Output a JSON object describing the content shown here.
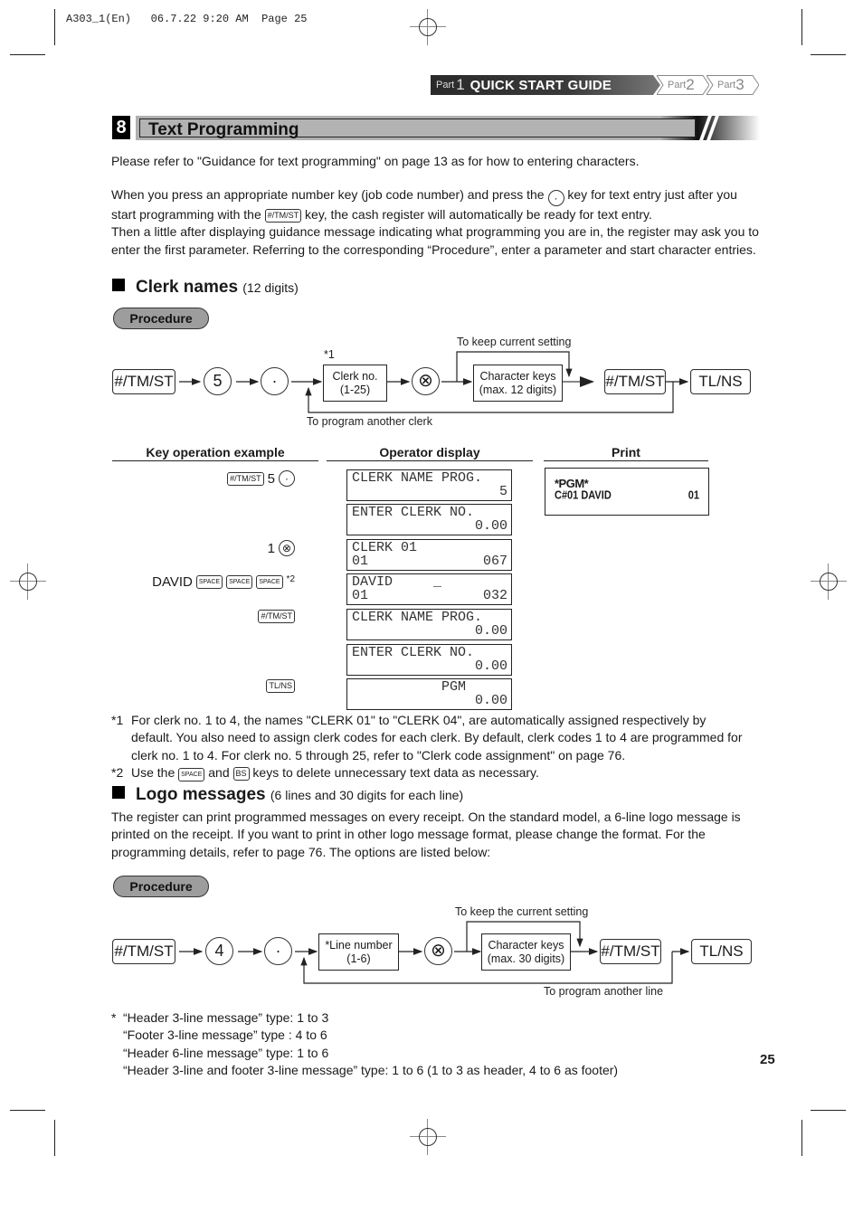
{
  "slug": {
    "file": "A303_1(En)",
    "date": "06.7.22",
    "time": "9:20 AM",
    "page_label": "Page 25"
  },
  "nav": {
    "parts": [
      {
        "prefix": "Part",
        "num": "1",
        "title": "QUICK START GUIDE",
        "active": true
      },
      {
        "prefix": "Part",
        "num": "2",
        "active": false
      },
      {
        "prefix": "Part",
        "num": "3",
        "active": false
      }
    ]
  },
  "section": {
    "number": "8",
    "title": "Text Programming"
  },
  "intro": {
    "p1": "Please refer to \"Guidance for text programming\" on page 13 as for how to entering characters.",
    "p2_a": "When you press an appropriate number key (job code number) and press the",
    "p2_key1": "·",
    "p2_b": "key for text entry just after you",
    "p2_c": "start programming with the",
    "p2_key2": "#/TM/ST",
    "p2_d": "key, the cash register will automatically be ready for text entry.",
    "p3": "Then a little after displaying guidance message indicating what programming you are in, the register may ask you to",
    "p4": "enter the first parameter.  Referring to the corresponding “Procedure”, enter a parameter and start character entries."
  },
  "clerk": {
    "heading": "Clerk names",
    "heading_sub": "(12 digits)",
    "procedure_label": "Procedure",
    "flow": {
      "key_start": "#/TM/ST",
      "key_num": "5",
      "key_dot": "·",
      "note1": "*1",
      "box1": [
        "Clerk no.",
        "(1-25)"
      ],
      "key_x": "⊗",
      "box2": [
        "Character keys",
        "(max. 12 digits)"
      ],
      "keep_note": "To keep current setting",
      "key_end1": "#/TM/ST",
      "key_end2": "TL/NS",
      "loop_note": "To program another clerk"
    },
    "columns": {
      "keyop": "Key operation example",
      "display": "Operator display",
      "print": "Print"
    },
    "rows": [
      {
        "keys": [
          {
            "t": "kbd",
            "v": "#/TM/ST"
          },
          {
            "t": "txt",
            "v": "5"
          },
          {
            "t": "circ",
            "v": "·"
          }
        ],
        "l1": "CLERK NAME PROG.",
        "l2": "5"
      },
      {
        "keys": [],
        "l1": "ENTER CLERK NO.",
        "l2": "0.00"
      },
      {
        "keys": [
          {
            "t": "txt",
            "v": "1"
          },
          {
            "t": "circ",
            "v": "⊗"
          }
        ],
        "l1": "CLERK 01",
        "l2a": "01",
        "l2": "067"
      },
      {
        "keys": [
          {
            "t": "txt",
            "v": "DAVID"
          },
          {
            "t": "kbd",
            "v": "SPACE"
          },
          {
            "t": "kbd",
            "v": "SPACE"
          },
          {
            "t": "kbd",
            "v": "SPACE"
          },
          {
            "t": "sup",
            "v": "*2"
          }
        ],
        "l1": "DAVID     _",
        "l2a": "01",
        "l2": "032"
      },
      {
        "keys": [
          {
            "t": "kbd",
            "v": "#/TM/ST"
          }
        ],
        "l1": "CLERK NAME PROG.",
        "l2": "0.00"
      },
      {
        "keys": [],
        "l1": "ENTER CLERK NO.",
        "l2": "0.00"
      },
      {
        "keys": [
          {
            "t": "kbd",
            "v": "TL/NS"
          }
        ],
        "l1": "           PGM",
        "l2": "0.00"
      }
    ],
    "print": {
      "line1": "*PGM*",
      "line2_left": "C#01 DAVID",
      "line2_right": "01"
    },
    "footnotes": {
      "n1_mark": "*1",
      "n1_l1": "For clerk no. 1 to 4, the names \"CLERK 01\" to \"CLERK 04\", are automatically assigned respectively by",
      "n1_l2": "default. You also need to assign clerk codes for each clerk. By default, clerk codes 1 to 4 are programmed for",
      "n1_l3": "clerk no. 1 to 4. For clerk no. 5 through 25, refer to \"Clerk code assignment\" on page 76.",
      "n2_mark": "*2",
      "n2_a": "Use the",
      "n2_key1": "SPACE",
      "n2_b": "and",
      "n2_key2": "BS",
      "n2_c": "keys to delete unnecessary text data as necessary."
    }
  },
  "logo": {
    "heading": "Logo messages",
    "heading_sub": "(6 lines and 30 digits for each line)",
    "p1": "The register can print programmed messages on every receipt. On the standard model, a 6-line logo message is",
    "p2": "printed on the receipt.  If you want to print in other logo message format, please change the format. For the",
    "p3": "programming details, refer to page 76.  The options are listed below:",
    "procedure_label": "Procedure",
    "flow": {
      "key_start": "#/TM/ST",
      "key_num": "4",
      "key_dot": "·",
      "box1": [
        "*Line number",
        "(1-6)"
      ],
      "key_x": "⊗",
      "box2": [
        "Character keys",
        "(max. 30 digits)"
      ],
      "keep_note": "To keep the current setting",
      "key_end1": "#/TM/ST",
      "key_end2": "TL/NS",
      "loop_note": "To program another line"
    },
    "options_mark": "*",
    "options": [
      "“Header 3-line message” type: 1 to 3",
      "“Footer 3-line message” type  : 4 to 6",
      "“Header 6-line message” type: 1 to 6",
      "“Header 3-line and footer 3-line message” type: 1 to 6 (1 to 3 as header, 4 to 6 as footer)"
    ]
  },
  "page_number": "25"
}
